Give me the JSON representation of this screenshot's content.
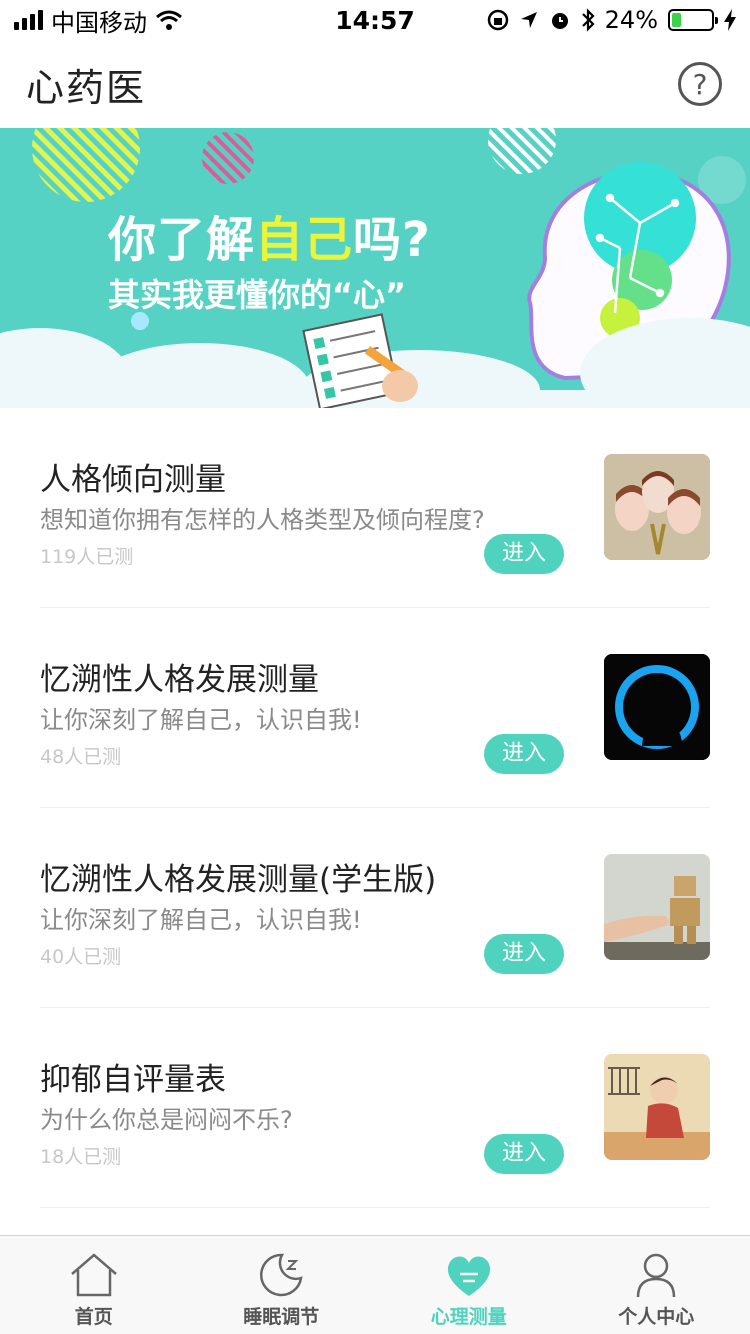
{
  "status": {
    "carrier": "中国移动",
    "time": "14:57",
    "battery": "24%",
    "battery_level": 0.24
  },
  "nav": {
    "title": "心药医",
    "help": "?"
  },
  "banner": {
    "line1_a": "你了解",
    "line1_highlight": "自己",
    "line1_b": "吗?",
    "line2": "其实我更懂你的“心”"
  },
  "tests": [
    {
      "title": "人格倾向测量",
      "desc": "想知道你拥有怎样的人格类型及倾向程度?",
      "count": "119人已测",
      "button": "进入"
    },
    {
      "title": "忆溯性人格发展测量",
      "desc": "让你深刻了解自己，认识自我!",
      "count": "48人已测",
      "button": "进入"
    },
    {
      "title": "忆溯性人格发展测量(学生版)",
      "desc": "让你深刻了解自己，认识自我!",
      "count": "40人已测",
      "button": "进入"
    },
    {
      "title": "抑郁自评量表",
      "desc": "为什么你总是闷闷不乐?",
      "count": "18人已测",
      "button": "进入"
    }
  ],
  "tabs": [
    {
      "label": "首页",
      "icon": "home-icon"
    },
    {
      "label": "睡眠调节",
      "icon": "moon-icon"
    },
    {
      "label": "心理测量",
      "icon": "heart-icon",
      "active": true
    },
    {
      "label": "个人中心",
      "icon": "person-icon"
    }
  ],
  "colors": {
    "accent": "#4fd3be",
    "banner_bg": "#56d2c4",
    "highlight": "#e8f53a"
  }
}
